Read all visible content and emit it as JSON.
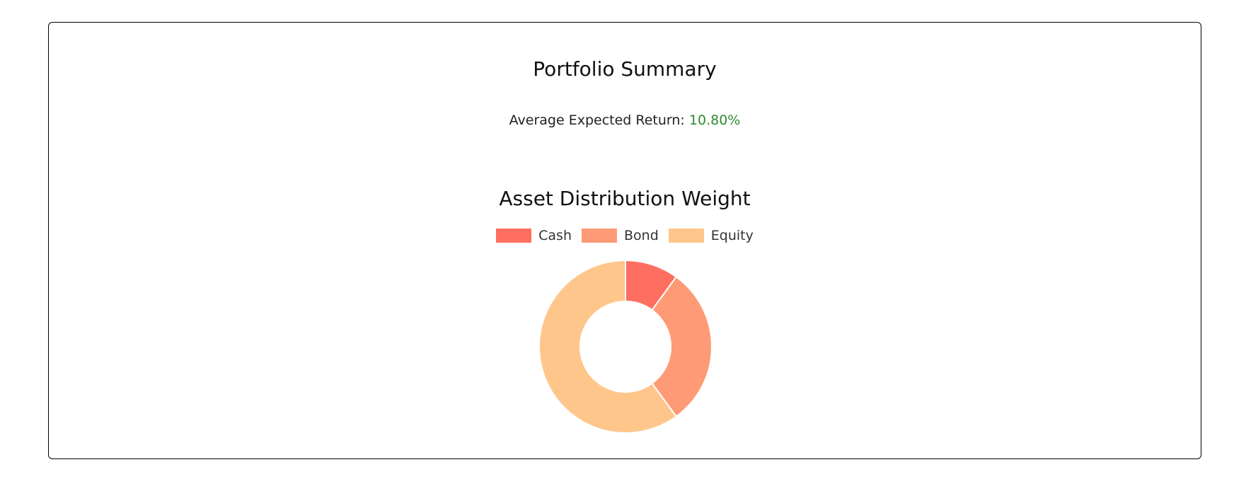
{
  "summary": {
    "title": "Portfolio Summary",
    "return_label": "Average Expected Return:",
    "return_value": "10.80%",
    "return_value_color": "#2e8b2e"
  },
  "chart_data": {
    "type": "pie",
    "title": "Asset Distribution Weight",
    "donut": true,
    "legend_position": "top",
    "categories": [
      "Cash",
      "Bond",
      "Equity"
    ],
    "values": [
      10,
      30,
      60
    ],
    "colors": [
      "#ff6f61",
      "#ff9a76",
      "#ffc68c"
    ],
    "legend": [
      {
        "label": "Cash",
        "color": "#ff6f61"
      },
      {
        "label": "Bond",
        "color": "#ff9a76"
      },
      {
        "label": "Equity",
        "color": "#ffc68c"
      }
    ]
  }
}
